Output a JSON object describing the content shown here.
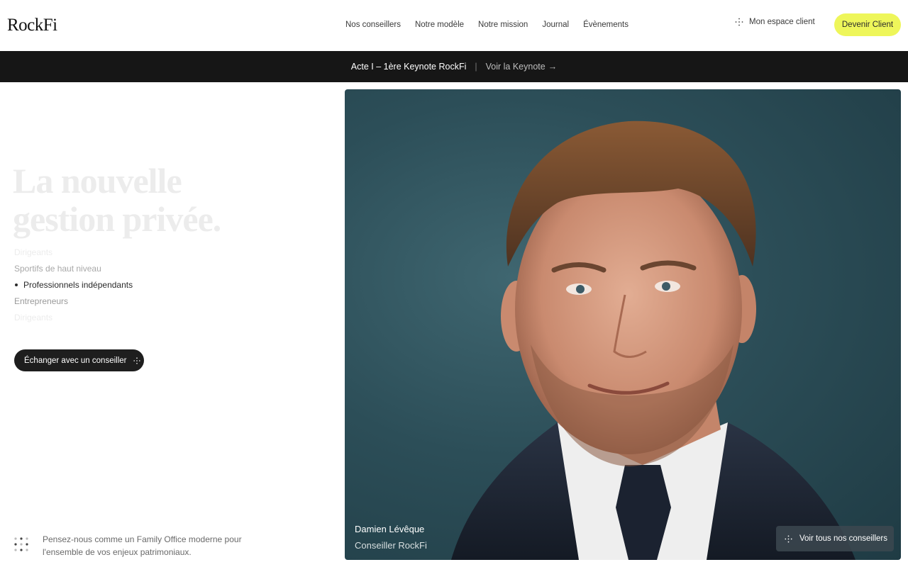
{
  "header": {
    "logo": "RockFi",
    "nav": [
      "Nos conseillers",
      "Notre modèle",
      "Notre mission",
      "Journal",
      "Évènements"
    ],
    "client_space": "Mon espace client",
    "cta": "Devenir Client",
    "cta_color": "#eef65a"
  },
  "banner": {
    "title": "Acte I – 1ère Keynote RockFi",
    "separator": "|",
    "link": "Voir la Keynote",
    "arrow": "→"
  },
  "hero": {
    "title_line1": "La nouvelle",
    "title_line2": "gestion privée.",
    "audiences": [
      "Dirigeants",
      "Sportifs de haut niveau",
      "Professionnels indépendants",
      "Entrepreneurs",
      "Dirigeants"
    ],
    "active_audience_index": 2,
    "cta": "Échanger avec un conseiller"
  },
  "advisor": {
    "name": "Damien Lévêque",
    "role": "Conseiller RockFi",
    "see_all": "Voir tous nos conseillers"
  },
  "footer_note": "Pensez-nous comme un Family Office moderne pour l'ensemble de vos enjeux patrimoniaux.",
  "icons": [
    "sparkle-icon",
    "arrow-right-icon",
    "dots-grid-icon"
  ]
}
